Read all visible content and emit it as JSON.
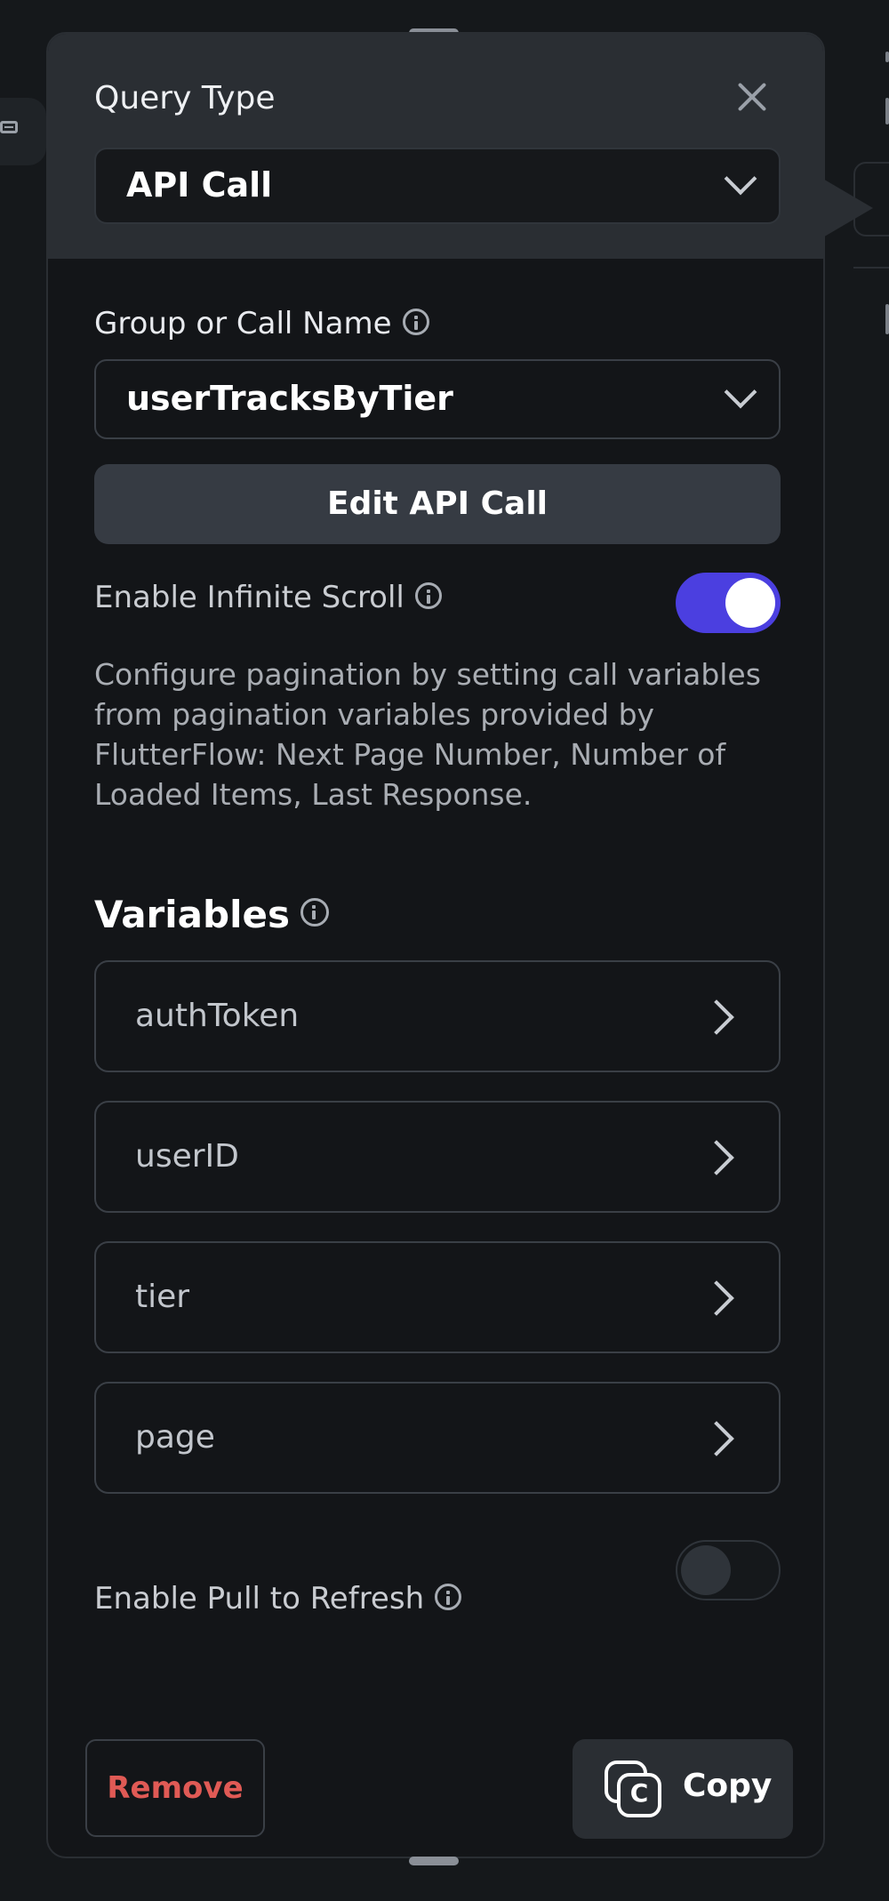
{
  "panel": {
    "header_title": "Query Type",
    "query_type_value": "API Call",
    "group_label": "Group or Call Name",
    "call_value": "userTracksByTier",
    "edit_button": "Edit API Call",
    "infinite_scroll_label": "Enable Infinite Scroll",
    "infinite_scroll_enabled": true,
    "description": "Configure pagination by setting call variables from pagination variables provided by FlutterFlow: Next Page Number, Number of Loaded Items, Last Response.",
    "variables_title": "Variables",
    "variables": [
      {
        "name": "authToken"
      },
      {
        "name": "userID"
      },
      {
        "name": "tier"
      },
      {
        "name": "page"
      }
    ],
    "pull_to_refresh_label": "Enable Pull to Refresh",
    "pull_to_refresh_enabled": false,
    "remove_button": "Remove",
    "copy_button": "Copy",
    "copy_icon_glyph": "C"
  },
  "colors": {
    "accent": "#4b3fe0",
    "danger": "#e05a55",
    "panel_bg": "#131518",
    "header_bg": "#2a2e33"
  },
  "icons": [
    "close-icon",
    "chevron-down-icon",
    "info-icon",
    "chevron-right-icon",
    "copy-icon"
  ]
}
